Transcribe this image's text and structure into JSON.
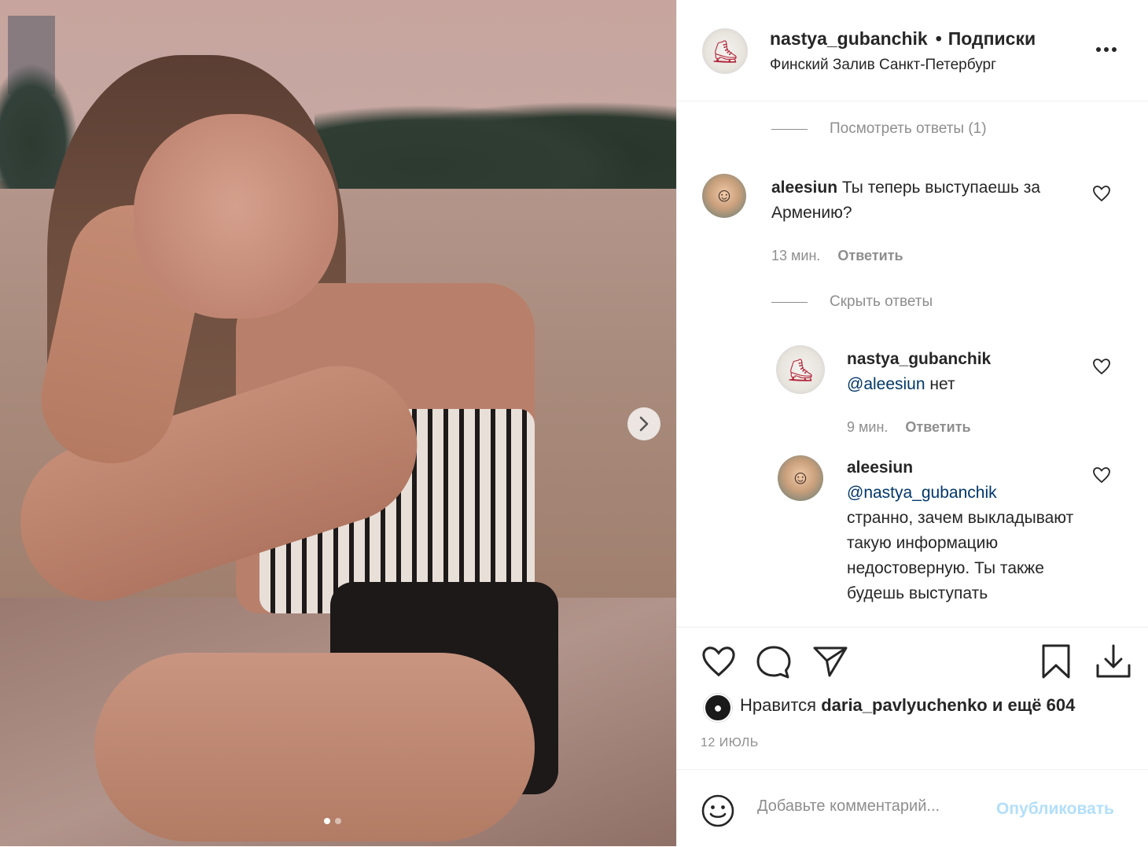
{
  "post": {
    "username": "nastya_gubanchik",
    "follow_label": "Подписки",
    "location": "Финский Залив Санкт-Петербург",
    "more_icon": "ellipsis-icon"
  },
  "comments": {
    "view_replies_label": "Посмотреть ответы (1)",
    "hide_replies_label": "Скрыть ответы",
    "reply_label": "Ответить",
    "items": [
      {
        "username": "aleesiun",
        "text": "Ты теперь выступаешь за Армению?",
        "time": "13 мин."
      }
    ],
    "replies": [
      {
        "username": "nastya_gubanchik",
        "mention": "@aleesiun",
        "text": "нет",
        "time": "9 мин."
      },
      {
        "username": "aleesiun",
        "mention": "@nastya_gubanchik",
        "text": "странно, зачем выкладывают такую информацию недостоверную. Ты также будешь выступать"
      }
    ]
  },
  "likes": {
    "prefix": "Нравится",
    "user": "daria_pavlyuchenko",
    "suffix": "и ещё 604"
  },
  "date": "12 ИЮЛЬ",
  "add_comment": {
    "placeholder": "Добавьте комментарий...",
    "publish_label": "Опубликовать"
  },
  "carousel": {
    "current": 1,
    "total": 2
  },
  "colors": {
    "text": "#262626",
    "secondary": "#8e8e8e",
    "mention": "#00376b",
    "publish_disabled": "#b2dffc",
    "divider": "#efefef"
  }
}
